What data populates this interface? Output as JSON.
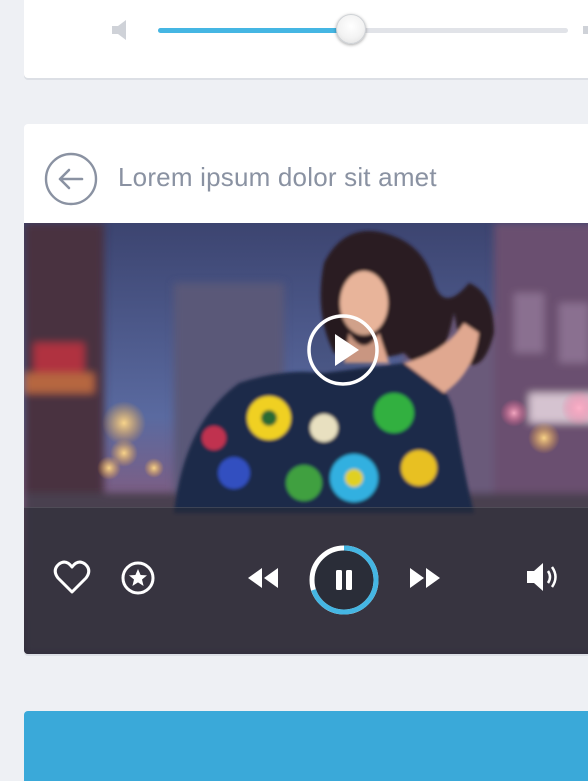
{
  "theme": {
    "accent": "#45b6e3",
    "title_color": "#8a92a2",
    "page_bg": "#eef0f4",
    "card_bg": "#ffffff",
    "bottom_card_color": "#3aa9d9"
  },
  "volume_card": {
    "low_icon": "speaker-mute-icon",
    "high_icon": "speaker-loud-icon",
    "volume_level": 0.47
  },
  "player_card": {
    "title": "Lorem ipsum dolor sit amet",
    "back_icon": "arrow-left-circle-icon",
    "video": {
      "description_icon": "play-circle-icon",
      "playback_progress": 0.7
    },
    "controls": {
      "heart_icon": "heart-icon",
      "star_icon": "star-circle-icon",
      "rewind_icon": "rewind-icon",
      "pause_icon": "pause-icon",
      "forward_icon": "fast-forward-icon",
      "volume_icon": "speaker-icon"
    }
  }
}
